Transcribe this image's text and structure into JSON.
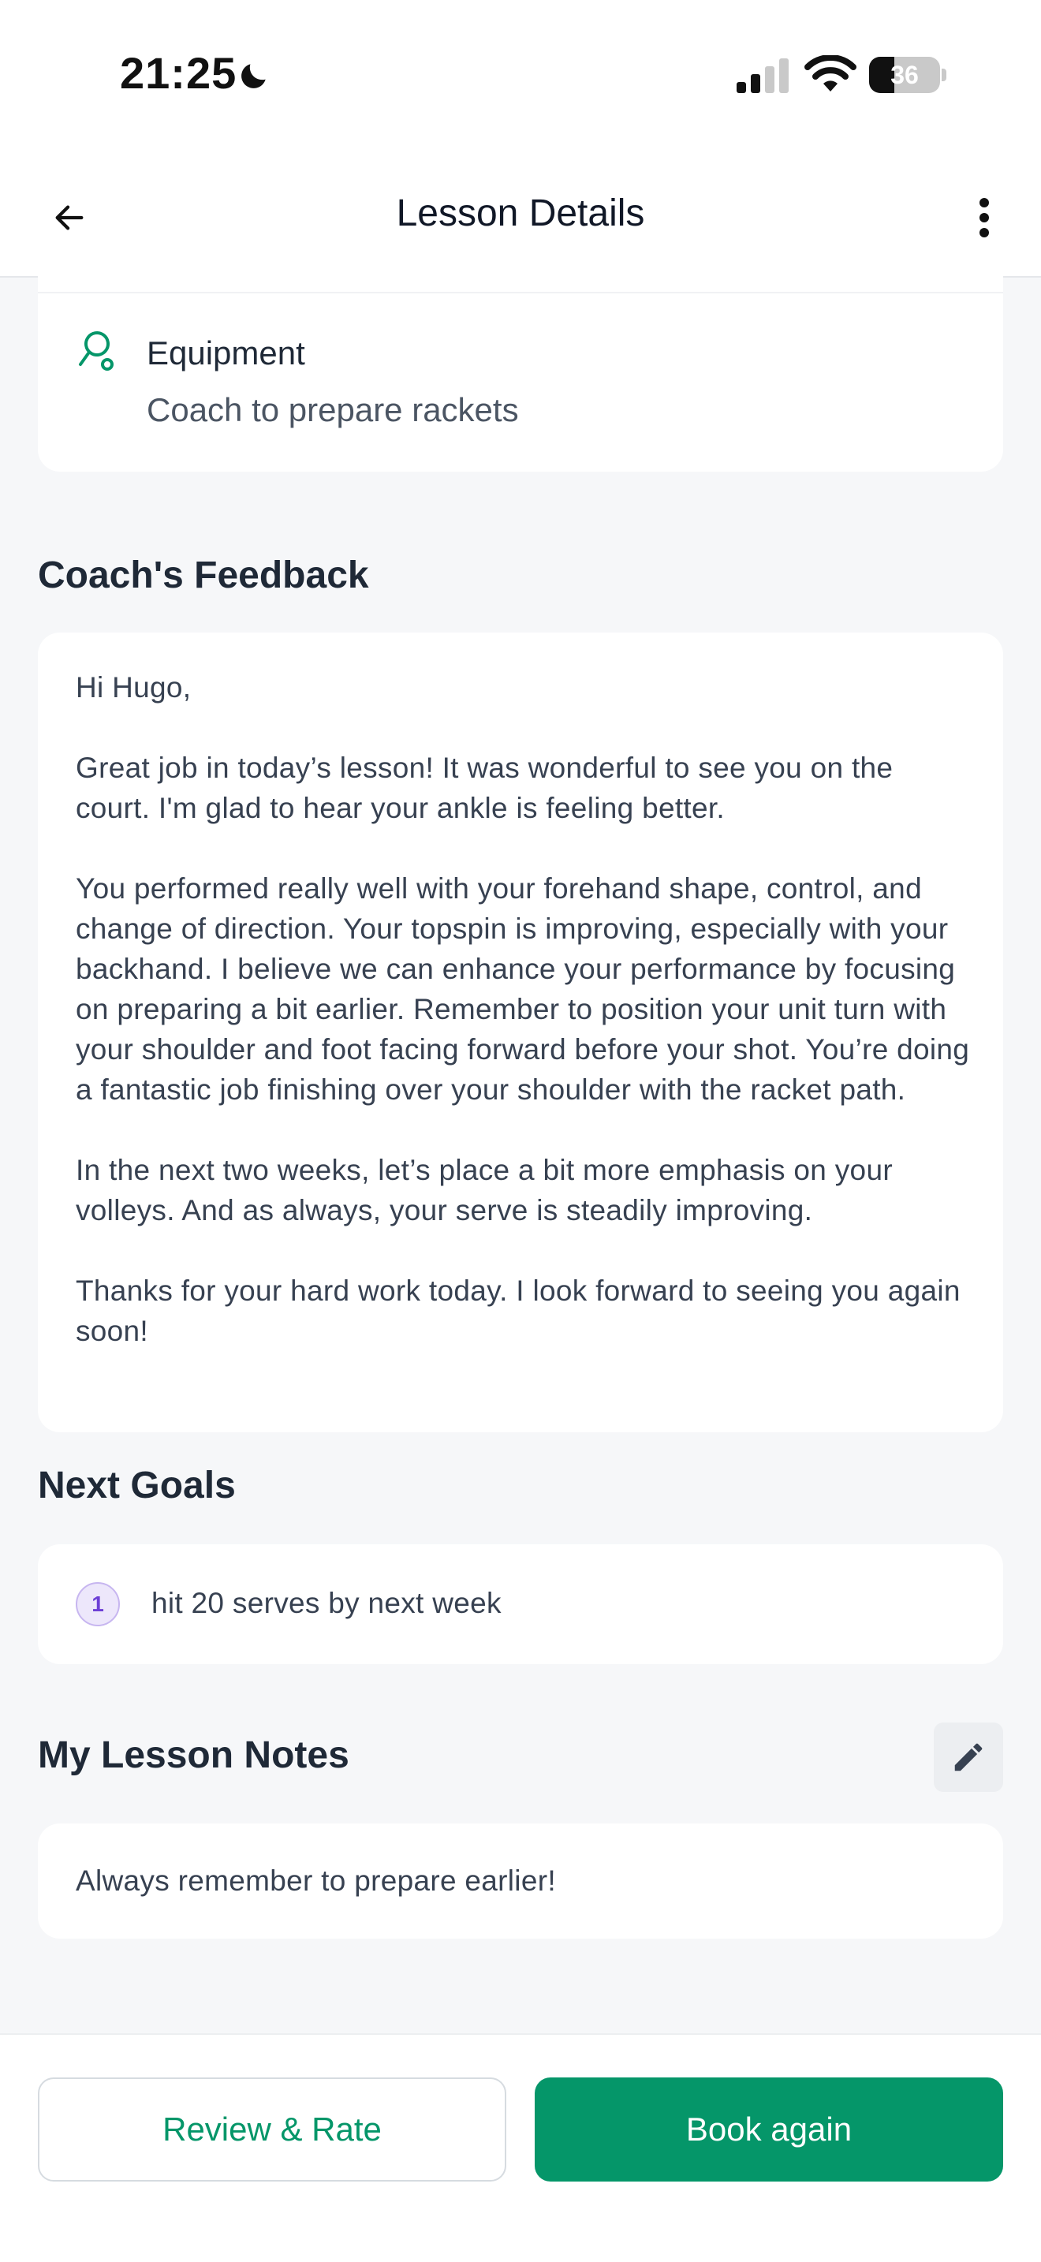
{
  "status_bar": {
    "time": "21:25",
    "battery_level": "36",
    "icons": [
      "moon-icon",
      "cellular-signal-icon",
      "wifi-icon",
      "battery-icon"
    ]
  },
  "header": {
    "title": "Lesson Details",
    "back_icon": "arrow-left-icon",
    "more_icon": "more-vertical-icon"
  },
  "equipment": {
    "icon": "racket-icon",
    "label": "Equipment",
    "value": "Coach to prepare rackets"
  },
  "feedback": {
    "section_title": "Coach's Feedback",
    "text": "Hi Hugo,\n\nGreat job in today’s lesson! It was wonderful to see you on the court. I'm glad to hear your ankle is feeling better.\n\nYou performed really well with your forehand shape, control, and change of direction. Your topspin is improving, especially with your backhand. I believe we can enhance your performance by focusing on preparing a bit earlier. Remember to position your unit turn with your shoulder and foot facing forward before your shot. You’re doing a fantastic job finishing over your shoulder with the racket path.\n\nIn the next two weeks, let’s place a bit more emphasis on your volleys. And as always, your serve is steadily improving.\n\nThanks for your hard work today. I look forward to seeing you again soon!"
  },
  "goals": {
    "section_title": "Next Goals",
    "items": [
      {
        "number": "1",
        "text": "hit 20 serves by next week"
      }
    ]
  },
  "notes": {
    "section_title": "My Lesson Notes",
    "edit_icon": "pencil-icon",
    "text": "Always remember to prepare earlier!"
  },
  "actions": {
    "review_label": "Review & Rate",
    "book_label": "Book again"
  },
  "colors": {
    "accent": "#059669",
    "background": "#f6f7f9",
    "goal_badge": "#ede7fb",
    "goal_badge_text": "#6d3fd6"
  }
}
